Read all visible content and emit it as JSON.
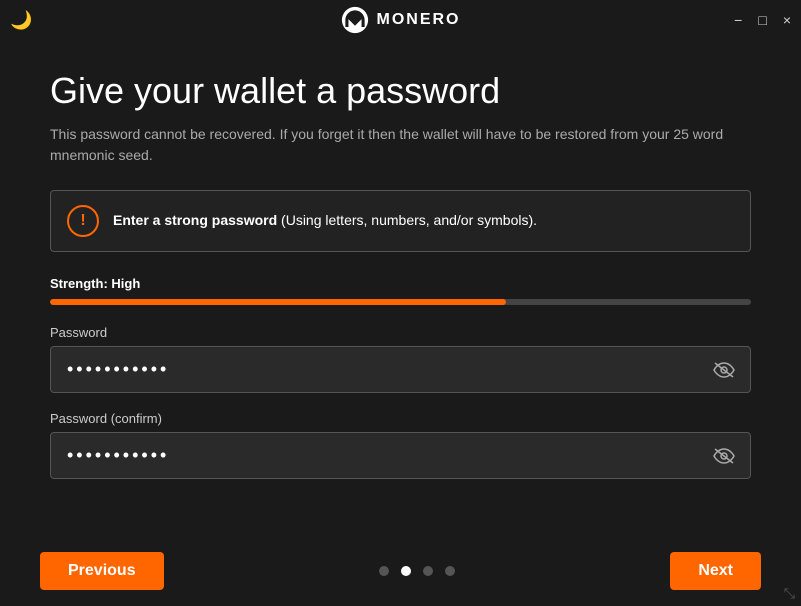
{
  "titlebar": {
    "app_name": "MONERO",
    "minimize_label": "−",
    "maximize_label": "□",
    "close_label": "×"
  },
  "page": {
    "title": "Give your wallet a password",
    "description": "This password cannot be recovered. If you forget it then the wallet will have to be restored from your 25 word mnemonic seed."
  },
  "alert": {
    "text_bold": "Enter a strong password",
    "text_normal": " (Using letters, numbers, and/or symbols)."
  },
  "strength": {
    "label": "Strength: High",
    "bar_percent": 65
  },
  "password_field": {
    "label": "Password",
    "value": "••••••••••",
    "placeholder": ""
  },
  "confirm_field": {
    "label": "Password (confirm)",
    "value": "••••••••••",
    "placeholder": ""
  },
  "navigation": {
    "previous_label": "Previous",
    "next_label": "Next",
    "dots": [
      {
        "active": false
      },
      {
        "active": true
      },
      {
        "active": false
      },
      {
        "active": false
      }
    ]
  }
}
